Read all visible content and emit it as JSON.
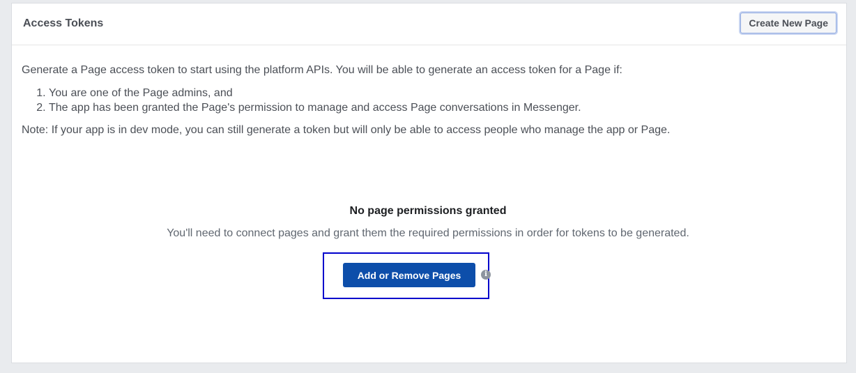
{
  "panel": {
    "title": "Access Tokens",
    "create_button_label": "Create New Page"
  },
  "content": {
    "intro": "Generate a Page access token to start using the platform APIs. You will be able to generate an access token for a Page if:",
    "conditions": [
      "You are one of the Page admins, and",
      "The app has been granted the Page's permission to manage and access Page conversations in Messenger."
    ],
    "note": "Note: If your app is in dev mode, you can still generate a token but will only be able to access people who manage the app or Page."
  },
  "empty_state": {
    "title": "No page permissions granted",
    "description": "You'll need to connect pages and grant them the required permissions in order for tokens to be generated.",
    "button_label": "Add or Remove Pages",
    "info_icon": "info-icon"
  },
  "colors": {
    "primary": "#0d4eaa",
    "highlight": "#0000cc",
    "background": "#e9ebee"
  }
}
